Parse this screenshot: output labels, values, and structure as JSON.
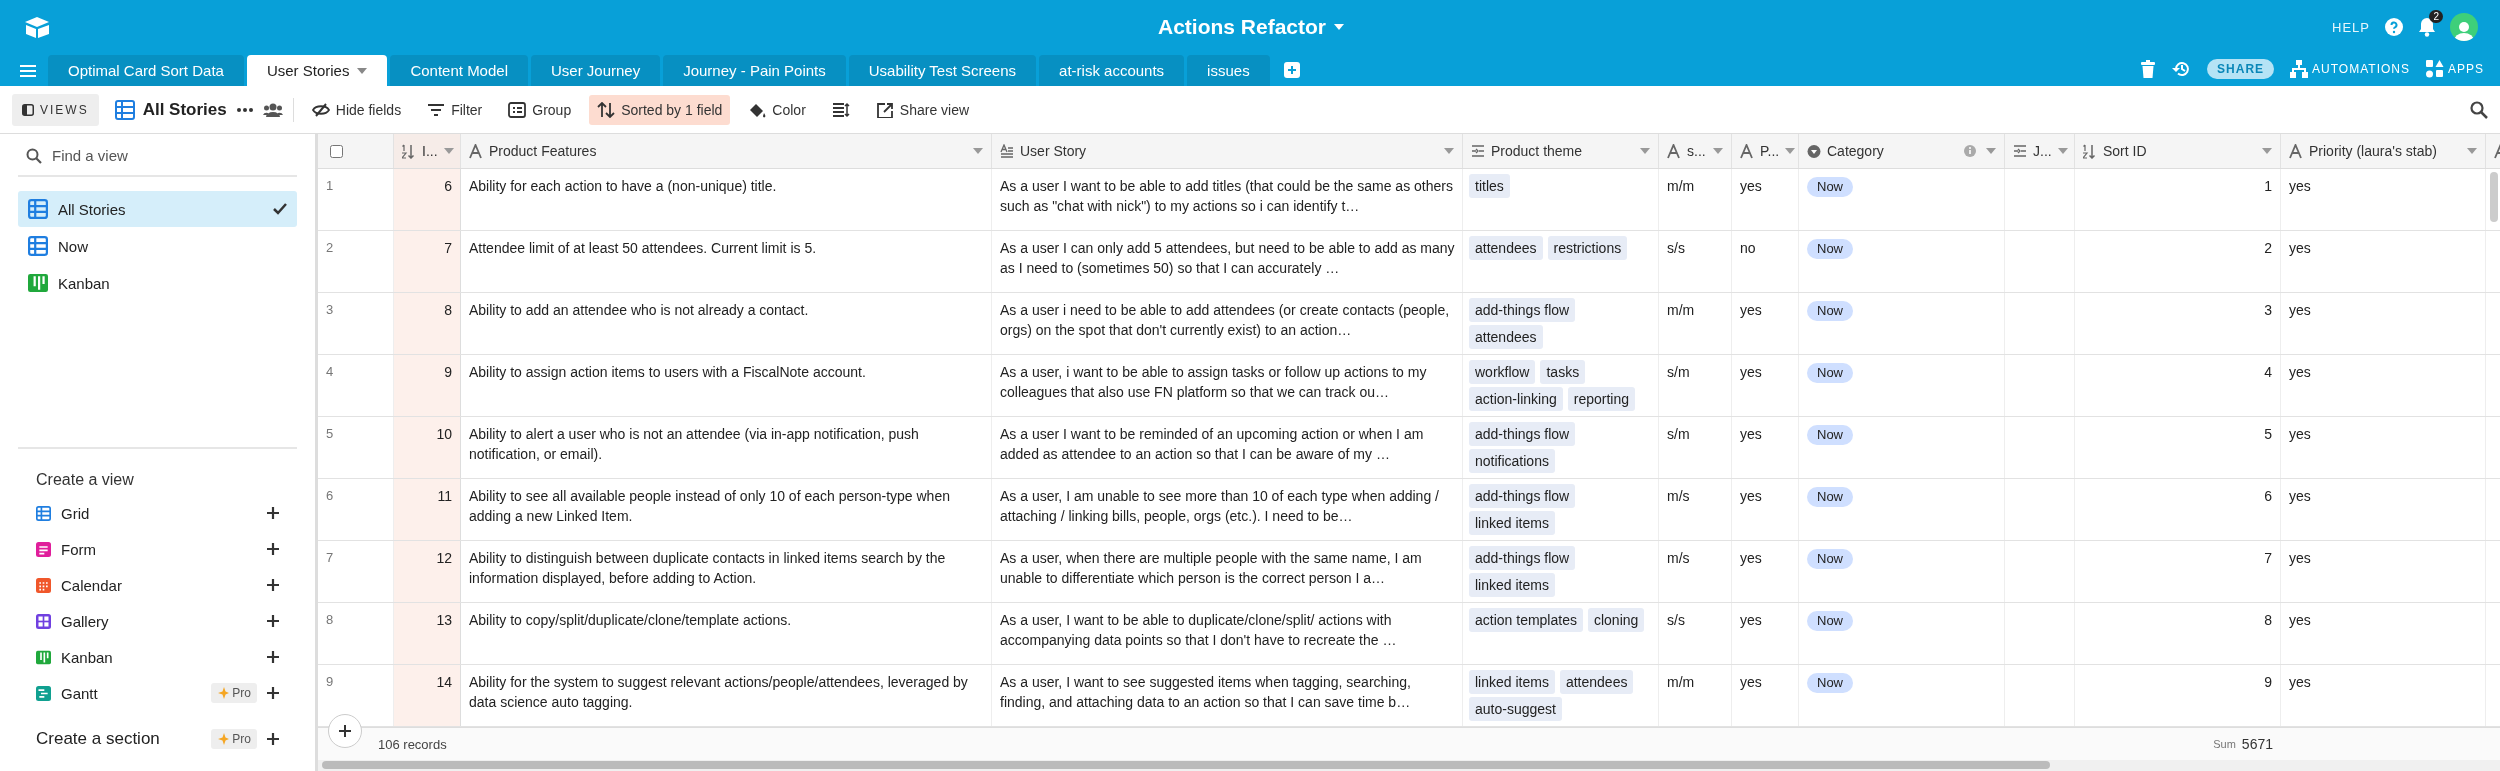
{
  "topbar": {
    "title": "Actions Refactor",
    "help": "HELP",
    "notifications": "2"
  },
  "tabs": [
    {
      "label": "Optimal Card Sort Data",
      "selected": false
    },
    {
      "label": "User Stories",
      "selected": true
    },
    {
      "label": "Content Model",
      "selected": false
    },
    {
      "label": "User Journey",
      "selected": false
    },
    {
      "label": "Journey - Pain Points",
      "selected": false
    },
    {
      "label": "Usability Test Screens",
      "selected": false
    },
    {
      "label": "at-risk accounts",
      "selected": false
    },
    {
      "label": "issues",
      "selected": false
    }
  ],
  "tab_actions": {
    "share": "SHARE",
    "automations": "AUTOMATIONS",
    "apps": "APPS"
  },
  "toolbar": {
    "views": "VIEWS",
    "view_name": "All Stories",
    "buttons": [
      {
        "kind": "hide",
        "label": "Hide fields",
        "active": false
      },
      {
        "kind": "filter",
        "label": "Filter",
        "active": false
      },
      {
        "kind": "group",
        "label": "Group",
        "active": false
      },
      {
        "kind": "sort",
        "label": "Sorted by 1 field",
        "active": true
      },
      {
        "kind": "color",
        "label": "Color",
        "active": false
      },
      {
        "kind": "height",
        "active": false
      },
      {
        "kind": "share",
        "label": "Share view",
        "active": false
      }
    ]
  },
  "sidebar": {
    "search": {
      "placeholder": "Find a view"
    },
    "views": [
      {
        "kind": "grid",
        "label": "All Stories",
        "selected": true
      },
      {
        "kind": "grid",
        "label": "Now",
        "selected": false
      },
      {
        "kind": "kanban",
        "label": "Kanban",
        "selected": false
      }
    ],
    "create_title": "Create a view",
    "create_items": [
      {
        "kind": "grid",
        "label": "Grid"
      },
      {
        "kind": "form",
        "label": "Form"
      },
      {
        "kind": "calendar",
        "label": "Calendar"
      },
      {
        "kind": "gallery",
        "label": "Gallery"
      },
      {
        "kind": "kanban",
        "label": "Kanban"
      },
      {
        "kind": "gantt",
        "label": "Gantt",
        "badge": "Pro"
      }
    ],
    "section": {
      "label": "Create a section",
      "badge": "Pro"
    }
  },
  "table": {
    "select_all": {
      "checked": false
    },
    "columns": [
      {
        "kind": "number",
        "label": "I...",
        "sorted": true
      },
      {
        "kind": "text",
        "label": "Product Features",
        "sorted": false
      },
      {
        "kind": "longtext",
        "label": "User Story",
        "sorted": false
      },
      {
        "kind": "multiselect",
        "label": "Product theme",
        "sorted": false
      },
      {
        "kind": "text",
        "label": "s...",
        "sorted": false
      },
      {
        "kind": "text",
        "label": "P...",
        "sorted": false
      },
      {
        "kind": "select",
        "label": "Category",
        "sorted": false,
        "info": true
      },
      {
        "kind": "multiselect",
        "label": "J...",
        "sorted": false
      },
      {
        "kind": "number",
        "label": "Sort ID",
        "sorted": false
      },
      {
        "kind": "text",
        "label": "Priority (laura's stab)",
        "sorted": false
      },
      {
        "kind": "text",
        "sorted": false
      }
    ],
    "rows": [
      {
        "num": "1",
        "id": "6",
        "feature": "Ability for each action to have a (non-unique) title.",
        "story": "As a user I want to be able to add titles (that could be the same as others such as \"chat with nick\") to my actions so i can identify t…",
        "themes": [
          "titles"
        ],
        "s": "m/m",
        "p": "yes",
        "category": "Now",
        "sort_id": "1",
        "priority": "yes"
      },
      {
        "num": "2",
        "id": "7",
        "feature": "Attendee limit of at least 50 attendees. Current limit is 5.",
        "story": "As a user I can only add 5 attendees, but need to be able to add as many as I need to (sometimes 50) so that I can accurately …",
        "themes": [
          "attendees",
          "restrictions"
        ],
        "s": "s/s",
        "p": "no",
        "category": "Now",
        "sort_id": "2",
        "priority": "yes"
      },
      {
        "num": "3",
        "id": "8",
        "feature": "Ability to add an attendee who is not already a contact.",
        "story": "As a user i need to be able to add attendees (or create contacts (people, orgs) on the spot that don't currently exist) to an action…",
        "themes": [
          "add-things flow",
          "attendees"
        ],
        "s": "m/m",
        "p": "yes",
        "category": "Now",
        "sort_id": "3",
        "priority": "yes"
      },
      {
        "num": "4",
        "id": "9",
        "feature": "Ability to assign action items to users with a FiscalNote account.",
        "story": "As a user, i want to be able to assign tasks or follow up actions to my colleagues that also use FN platform so that we can track ou…",
        "themes": [
          "workflow",
          "tasks",
          "action-linking",
          "reporting"
        ],
        "s": "s/m",
        "p": "yes",
        "category": "Now",
        "sort_id": "4",
        "priority": "yes"
      },
      {
        "num": "5",
        "id": "10",
        "feature": "Ability to alert a user who is not an attendee (via in-app notification, push notification, or email).",
        "story": "As a user I want to be reminded of an upcoming action or when I am added as attendee to an action so that I can be aware of my …",
        "themes": [
          "add-things flow",
          "notifications"
        ],
        "s": "s/m",
        "p": "yes",
        "category": "Now",
        "sort_id": "5",
        "priority": "yes"
      },
      {
        "num": "6",
        "id": "11",
        "feature": "Ability to see all available people instead of only 10 of each person-type when adding a new Linked Item.",
        "story": "As a user, I am unable to see more than 10 of each type when adding / attaching / linking bills, people, orgs (etc.). I need to be…",
        "themes": [
          "add-things flow",
          "linked items"
        ],
        "s": "m/s",
        "p": "yes",
        "category": "Now",
        "sort_id": "6",
        "priority": "yes"
      },
      {
        "num": "7",
        "id": "12",
        "feature": "Ability to distinguish between duplicate contacts in linked items search by the information displayed, before adding to Action.",
        "story": "As a user, when there are multiple people with the same name, I am unable to differentiate which person is the correct person I a…",
        "themes": [
          "add-things flow",
          "linked items"
        ],
        "s": "m/s",
        "p": "yes",
        "category": "Now",
        "sort_id": "7",
        "priority": "yes"
      },
      {
        "num": "8",
        "id": "13",
        "feature": "Ability to copy/split/duplicate/clone/template actions.",
        "story": "As a user, I want to be able to duplicate/clone/split/ actions with accompanying data points so that I don't have to recreate the …",
        "themes": [
          "action templates",
          "cloning"
        ],
        "s": "s/s",
        "p": "yes",
        "category": "Now",
        "sort_id": "8",
        "priority": "yes"
      },
      {
        "num": "9",
        "id": "14",
        "feature": "Ability for the system to suggest relevant actions/people/attendees, leveraged by data science auto tagging.",
        "story": "As a user, I want to see suggested items when tagging, searching, finding, and attaching data to an action so that I can save time b…",
        "themes": [
          "linked items",
          "attendees",
          "auto-suggest"
        ],
        "s": "m/m",
        "p": "yes",
        "category": "Now",
        "sort_id": "9",
        "priority": "yes"
      }
    ],
    "footer": {
      "records": "106 records",
      "sum_label": "Sum",
      "sum": "5671"
    }
  }
}
